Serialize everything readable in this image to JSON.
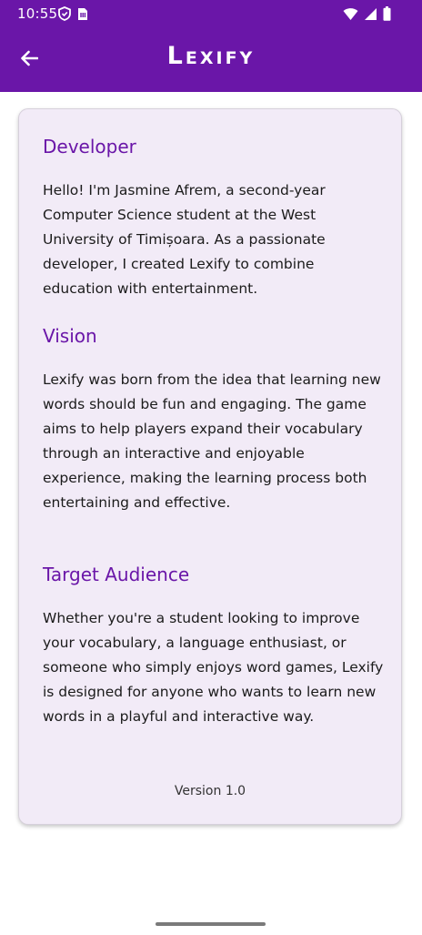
{
  "status_bar": {
    "time": "10:55"
  },
  "app_bar": {
    "title": "Lexify"
  },
  "sections": [
    {
      "heading": "Developer",
      "body": "Hello! I'm Jasmine Afrem, a second-year Computer Science student at the West University of Timișoara. As a passionate developer, I created Lexify to combine education with entertainment."
    },
    {
      "heading": "Vision",
      "body": "Lexify was born from the idea that learning new words should be fun and engaging. The game aims to help players expand their vocabulary through an interactive and enjoyable experience, making the learning process both entertaining and effective."
    },
    {
      "heading": "Target Audience",
      "body": "Whether you're a student looking to improve your vocabulary, a language enthusiast, or someone who simply enjoys word games, Lexify is designed for anyone who wants to learn new words in a playful and interactive way."
    }
  ],
  "version": "Version 1.0",
  "colors": {
    "primary": "#6a16a8",
    "card_background": "#f2ebf7",
    "heading": "#6a16a8"
  },
  "icons": {
    "back": "arrow-back-icon",
    "shield": "shield-icon",
    "sim": "sim-card-icon",
    "wifi": "wifi-icon",
    "signal": "signal-icon",
    "battery": "battery-icon"
  }
}
